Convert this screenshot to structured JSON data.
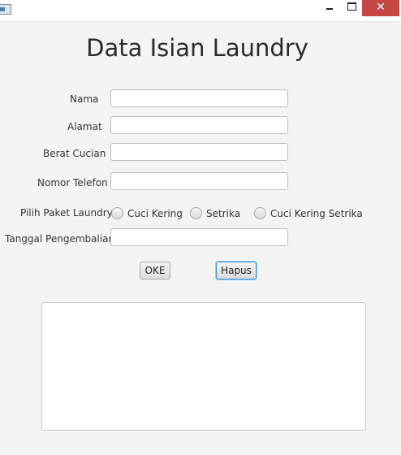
{
  "window": {
    "close_glyph": "✕"
  },
  "form": {
    "title": "Data Isian Laundry",
    "fields": {
      "nama": {
        "label": "Nama",
        "value": ""
      },
      "alamat": {
        "label": "Alamat",
        "value": ""
      },
      "berat": {
        "label": "Berat Cucian",
        "value": ""
      },
      "telefon": {
        "label": "Nomor Telefon",
        "value": ""
      },
      "tanggal": {
        "label": "Tanggal Pengembalian",
        "value": ""
      }
    },
    "paket": {
      "label": "Pilih Paket Laundry",
      "options": [
        "Cuci Kering",
        "Setrika",
        "Cuci Kering Setrika"
      ]
    },
    "buttons": {
      "oke": "OKE",
      "hapus": "Hapus"
    },
    "output": ""
  },
  "colors": {
    "close_button": "#c74646",
    "focus_border": "#3d8fd1"
  },
  "icons": [
    "app-icon",
    "minimize-icon",
    "maximize-icon",
    "close-icon"
  ]
}
